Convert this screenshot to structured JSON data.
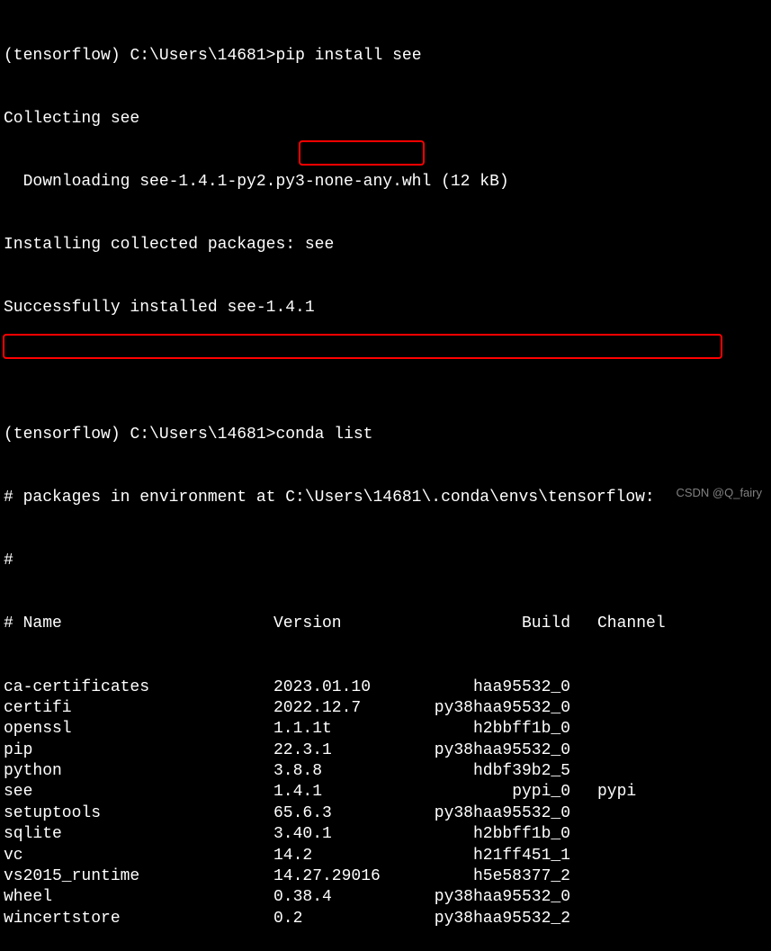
{
  "cmd1": {
    "prompt_env": "(tensorflow)",
    "prompt_path": "C:\\Users\\14681>",
    "command": "pip install see",
    "out1": "Collecting see",
    "out2": "  Downloading see-1.4.1-py2.py3-none-any.whl (12 kB)",
    "out3": "Installing collected packages: see",
    "out4": "Successfully installed see-1.4.1"
  },
  "cmd2": {
    "prompt_env": "(tensorflow)",
    "prompt_path": "C:\\Users\\14681>",
    "command": "conda list",
    "out1": "# packages in environment at C:\\Users\\14681\\.conda\\envs\\tensorflow:",
    "out2": "#"
  },
  "header": {
    "name": "# Name",
    "version": "Version",
    "build": "Build",
    "channel": "Channel"
  },
  "packages": [
    {
      "name": "ca-certificates",
      "version": "2023.01.10",
      "build": "haa95532_0",
      "channel": ""
    },
    {
      "name": "certifi",
      "version": "2022.12.7",
      "build": "py38haa95532_0",
      "channel": ""
    },
    {
      "name": "openssl",
      "version": "1.1.1t",
      "build": "h2bbff1b_0",
      "channel": ""
    },
    {
      "name": "pip",
      "version": "22.3.1",
      "build": "py38haa95532_0",
      "channel": ""
    },
    {
      "name": "python",
      "version": "3.8.8",
      "build": "hdbf39b2_5",
      "channel": ""
    },
    {
      "name": "see",
      "version": "1.4.1",
      "build": "pypi_0",
      "channel": "pypi"
    },
    {
      "name": "setuptools",
      "version": "65.6.3",
      "build": "py38haa95532_0",
      "channel": ""
    },
    {
      "name": "sqlite",
      "version": "3.40.1",
      "build": "h2bbff1b_0",
      "channel": ""
    },
    {
      "name": "vc",
      "version": "14.2",
      "build": "h21ff451_1",
      "channel": ""
    },
    {
      "name": "vs2015_runtime",
      "version": "14.27.29016",
      "build": "h5e58377_2",
      "channel": ""
    },
    {
      "name": "wheel",
      "version": "0.38.4",
      "build": "py38haa95532_0",
      "channel": ""
    },
    {
      "name": "wincertstore",
      "version": "0.2",
      "build": "py38haa95532_2",
      "channel": ""
    }
  ],
  "watermark": "CSDN @Q_fairy"
}
